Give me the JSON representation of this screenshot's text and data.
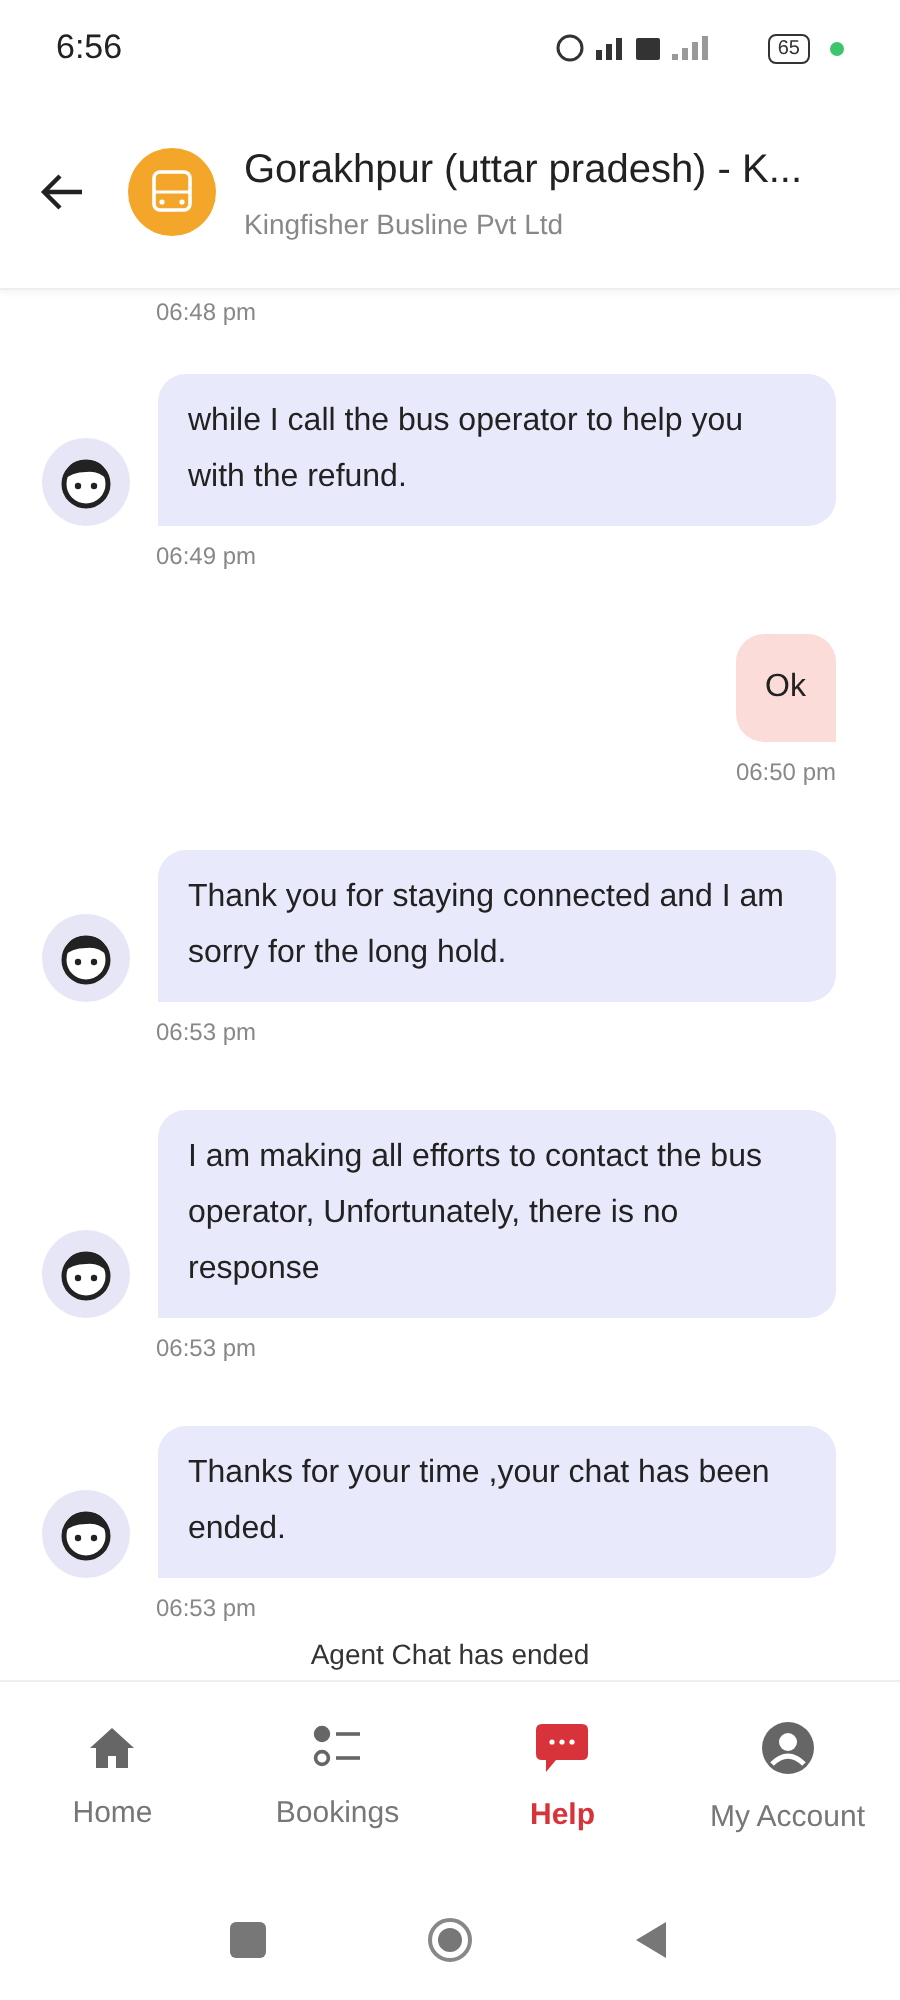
{
  "status_bar": {
    "time": "6:56",
    "battery": "65"
  },
  "header": {
    "title": "Gorakhpur (uttar pradesh) - K...",
    "subtitle": "Kingfisher Busline Pvt Ltd"
  },
  "chat": {
    "leading_time": "06:48 pm",
    "messages": [
      {
        "kind": "agent",
        "text": "while I call the bus operator to help you with the refund.",
        "time": "06:49 pm"
      },
      {
        "kind": "user",
        "text": "Ok",
        "time": "06:50 pm"
      },
      {
        "kind": "agent",
        "text": "Thank you for staying connected and I am sorry for the long hold.",
        "time": "06:53 pm"
      },
      {
        "kind": "agent",
        "text": "I am making all efforts to contact the bus operator, Unfortunately, there is no response",
        "time": "06:53 pm"
      },
      {
        "kind": "agent",
        "text": "Thanks for your time ,your chat has been ended.",
        "time": "06:53 pm"
      }
    ],
    "notice": "Agent Chat has ended"
  },
  "nav": [
    {
      "label": "Home",
      "kind": "home",
      "selected": false
    },
    {
      "label": "Bookings",
      "kind": "bookings",
      "selected": false
    },
    {
      "label": "Help",
      "kind": "help",
      "selected": true
    },
    {
      "label": "My Account",
      "kind": "account",
      "selected": false
    }
  ]
}
